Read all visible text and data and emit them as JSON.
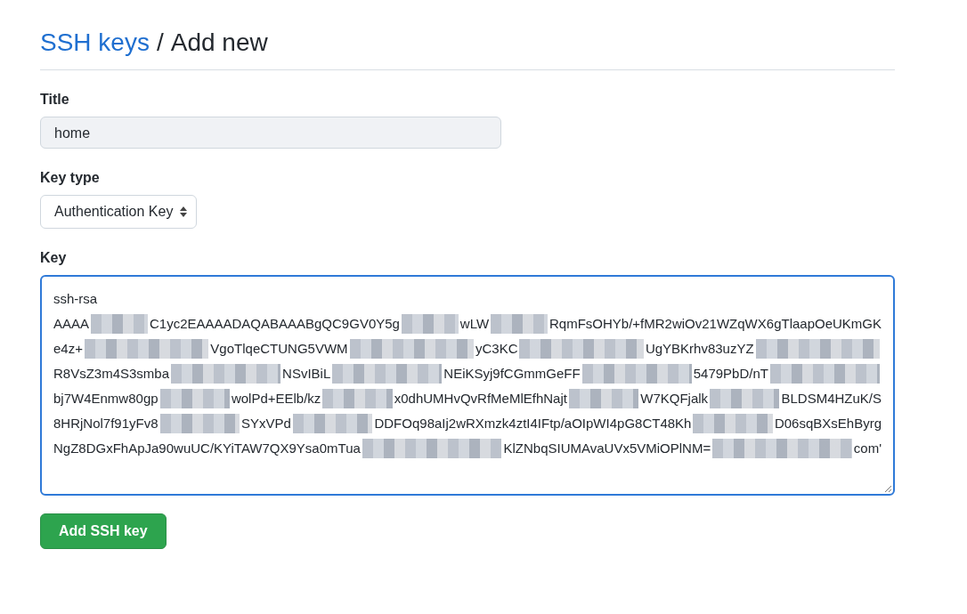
{
  "breadcrumb": {
    "link": "SSH keys",
    "separator": "/",
    "current": "Add new"
  },
  "title_field": {
    "label": "Title",
    "value": "home"
  },
  "key_type": {
    "label": "Key type",
    "value": "Authentication Key"
  },
  "key_field": {
    "label": "Key",
    "focused": true,
    "lines": [
      [
        {
          "kind": "text",
          "text": "ssh-rsa"
        }
      ],
      [
        {
          "kind": "text",
          "text": "AAAA"
        },
        {
          "kind": "redacted"
        },
        {
          "kind": "text",
          "text": "C1yc2EAAAADAQABAAABgQC9GV0Y5g"
        },
        {
          "kind": "redacted"
        },
        {
          "kind": "text",
          "text": "wLW"
        },
        {
          "kind": "redacted"
        },
        {
          "kind": "text",
          "text": "RqmFsOHYb/+fMR2wiOv21WZqWX6gTlaapOeUKmGK"
        }
      ],
      [
        {
          "kind": "text",
          "text": "e4z+"
        },
        {
          "kind": "redacted"
        },
        {
          "kind": "text",
          "text": "VgoTlqeCTUNG5VWM"
        },
        {
          "kind": "redacted"
        },
        {
          "kind": "text",
          "text": "yC3KC"
        },
        {
          "kind": "redacted"
        },
        {
          "kind": "text",
          "text": "UgYBKrhv83uzYZ"
        },
        {
          "kind": "redacted"
        }
      ],
      [
        {
          "kind": "text",
          "text": "R8VsZ3m4S3smba"
        },
        {
          "kind": "redacted"
        },
        {
          "kind": "text",
          "text": "NSvIBiL"
        },
        {
          "kind": "redacted"
        },
        {
          "kind": "text",
          "text": "NEiKSyj9fCGmmGeFF"
        },
        {
          "kind": "redacted"
        },
        {
          "kind": "text",
          "text": "5479PbD/nT"
        },
        {
          "kind": "redacted"
        }
      ],
      [
        {
          "kind": "text",
          "text": "bj7W4Enmw80gp"
        },
        {
          "kind": "redacted"
        },
        {
          "kind": "text",
          "text": "wolPd+EElb/kz"
        },
        {
          "kind": "redacted"
        },
        {
          "kind": "text",
          "text": "x0dhUMHvQvRfMeMlEfhNajt"
        },
        {
          "kind": "redacted"
        },
        {
          "kind": "text",
          "text": "W7KQFjalk"
        },
        {
          "kind": "redacted"
        },
        {
          "kind": "text",
          "text": "BLDSM4HZuK/S"
        }
      ],
      [
        {
          "kind": "text",
          "text": "8HRjNol7f91yFv8"
        },
        {
          "kind": "redacted"
        },
        {
          "kind": "text",
          "text": "SYxVPd"
        },
        {
          "kind": "redacted"
        },
        {
          "kind": "text",
          "text": "DDFOq98aIj2wRXmzk4ztI4IFtp/aOIpWI4pG8CT48Kh"
        },
        {
          "kind": "redacted"
        },
        {
          "kind": "text",
          "text": "D06sqBXsEhByrg"
        }
      ],
      [
        {
          "kind": "text",
          "text": "NgZ8DGxFhApJa90wuUC/KYiTAW7QX9Ysa0mTua"
        },
        {
          "kind": "redacted"
        },
        {
          "kind": "text",
          "text": "KlZNbqSIUMAvaUVx5VMiOPlNM="
        },
        {
          "kind": "redacted"
        },
        {
          "kind": "text",
          "text": "com'"
        }
      ]
    ]
  },
  "submit_button": "Add SSH key"
}
